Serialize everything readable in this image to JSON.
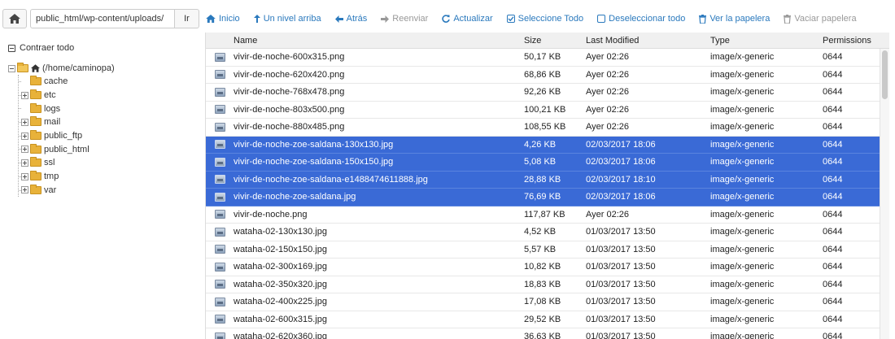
{
  "path_bar": {
    "home_icon": "home-icon",
    "path_value": "public_html/wp-content/uploads/",
    "go_label": "Ir"
  },
  "toolbar": {
    "items": [
      {
        "label": "Inicio",
        "icon": "home-icon",
        "enabled": true
      },
      {
        "label": "Un nivel arriba",
        "icon": "level-up-icon",
        "enabled": true
      },
      {
        "label": "Atrás",
        "icon": "arrow-left-icon",
        "enabled": true
      },
      {
        "label": "Reenviar",
        "icon": "arrow-right-icon",
        "enabled": false
      },
      {
        "label": "Actualizar",
        "icon": "refresh-icon",
        "enabled": true
      },
      {
        "label": "Seleccione Todo",
        "icon": "checkbox-checked-icon",
        "enabled": true
      },
      {
        "label": "Deseleccionar todo",
        "icon": "checkbox-empty-icon",
        "enabled": true
      },
      {
        "label": "Ver la papelera",
        "icon": "trash-icon",
        "enabled": true
      },
      {
        "label": "Vaciar papelera",
        "icon": "trash-icon",
        "enabled": false
      }
    ]
  },
  "tree": {
    "collapse_label": "Contraer todo",
    "root_label": "(/home/caminopa)",
    "children": [
      {
        "label": "cache",
        "expandable": false
      },
      {
        "label": "etc",
        "expandable": true
      },
      {
        "label": "logs",
        "expandable": false
      },
      {
        "label": "mail",
        "expandable": true
      },
      {
        "label": "public_ftp",
        "expandable": true
      },
      {
        "label": "public_html",
        "expandable": true
      },
      {
        "label": "ssl",
        "expandable": true
      },
      {
        "label": "tmp",
        "expandable": true
      },
      {
        "label": "var",
        "expandable": true
      }
    ]
  },
  "table": {
    "headers": {
      "name": "Name",
      "size": "Size",
      "modified": "Last Modified",
      "type": "Type",
      "permissions": "Permissions"
    },
    "rows": [
      {
        "name": "vivir-de-noche-600x315.png",
        "size": "50,17 KB",
        "modified": "Ayer 02:26",
        "type": "image/x-generic",
        "perm": "0644",
        "selected": false
      },
      {
        "name": "vivir-de-noche-620x420.png",
        "size": "68,86 KB",
        "modified": "Ayer 02:26",
        "type": "image/x-generic",
        "perm": "0644",
        "selected": false
      },
      {
        "name": "vivir-de-noche-768x478.png",
        "size": "92,26 KB",
        "modified": "Ayer 02:26",
        "type": "image/x-generic",
        "perm": "0644",
        "selected": false
      },
      {
        "name": "vivir-de-noche-803x500.png",
        "size": "100,21 KB",
        "modified": "Ayer 02:26",
        "type": "image/x-generic",
        "perm": "0644",
        "selected": false
      },
      {
        "name": "vivir-de-noche-880x485.png",
        "size": "108,55 KB",
        "modified": "Ayer 02:26",
        "type": "image/x-generic",
        "perm": "0644",
        "selected": false
      },
      {
        "name": "vivir-de-noche-zoe-saldana-130x130.jpg",
        "size": "4,26 KB",
        "modified": "02/03/2017 18:06",
        "type": "image/x-generic",
        "perm": "0644",
        "selected": true
      },
      {
        "name": "vivir-de-noche-zoe-saldana-150x150.jpg",
        "size": "5,08 KB",
        "modified": "02/03/2017 18:06",
        "type": "image/x-generic",
        "perm": "0644",
        "selected": true
      },
      {
        "name": "vivir-de-noche-zoe-saldana-e1488474611888.jpg",
        "size": "28,88 KB",
        "modified": "02/03/2017 18:10",
        "type": "image/x-generic",
        "perm": "0644",
        "selected": true
      },
      {
        "name": "vivir-de-noche-zoe-saldana.jpg",
        "size": "76,69 KB",
        "modified": "02/03/2017 18:06",
        "type": "image/x-generic",
        "perm": "0644",
        "selected": true
      },
      {
        "name": "vivir-de-noche.png",
        "size": "117,87 KB",
        "modified": "Ayer 02:26",
        "type": "image/x-generic",
        "perm": "0644",
        "selected": false
      },
      {
        "name": "wataha-02-130x130.jpg",
        "size": "4,52 KB",
        "modified": "01/03/2017 13:50",
        "type": "image/x-generic",
        "perm": "0644",
        "selected": false
      },
      {
        "name": "wataha-02-150x150.jpg",
        "size": "5,57 KB",
        "modified": "01/03/2017 13:50",
        "type": "image/x-generic",
        "perm": "0644",
        "selected": false
      },
      {
        "name": "wataha-02-300x169.jpg",
        "size": "10,82 KB",
        "modified": "01/03/2017 13:50",
        "type": "image/x-generic",
        "perm": "0644",
        "selected": false
      },
      {
        "name": "wataha-02-350x320.jpg",
        "size": "18,83 KB",
        "modified": "01/03/2017 13:50",
        "type": "image/x-generic",
        "perm": "0644",
        "selected": false
      },
      {
        "name": "wataha-02-400x225.jpg",
        "size": "17,08 KB",
        "modified": "01/03/2017 13:50",
        "type": "image/x-generic",
        "perm": "0644",
        "selected": false
      },
      {
        "name": "wataha-02-600x315.jpg",
        "size": "29,52 KB",
        "modified": "01/03/2017 13:50",
        "type": "image/x-generic",
        "perm": "0644",
        "selected": false
      },
      {
        "name": "wataha-02-620x360.jpg",
        "size": "36,63 KB",
        "modified": "01/03/2017 13:50",
        "type": "image/x-generic",
        "perm": "0644",
        "selected": false
      }
    ]
  },
  "colors": {
    "link": "#2a79bd",
    "selection": "#3a6ad6",
    "disabled": "#999999",
    "folder": "#e8b23a"
  }
}
